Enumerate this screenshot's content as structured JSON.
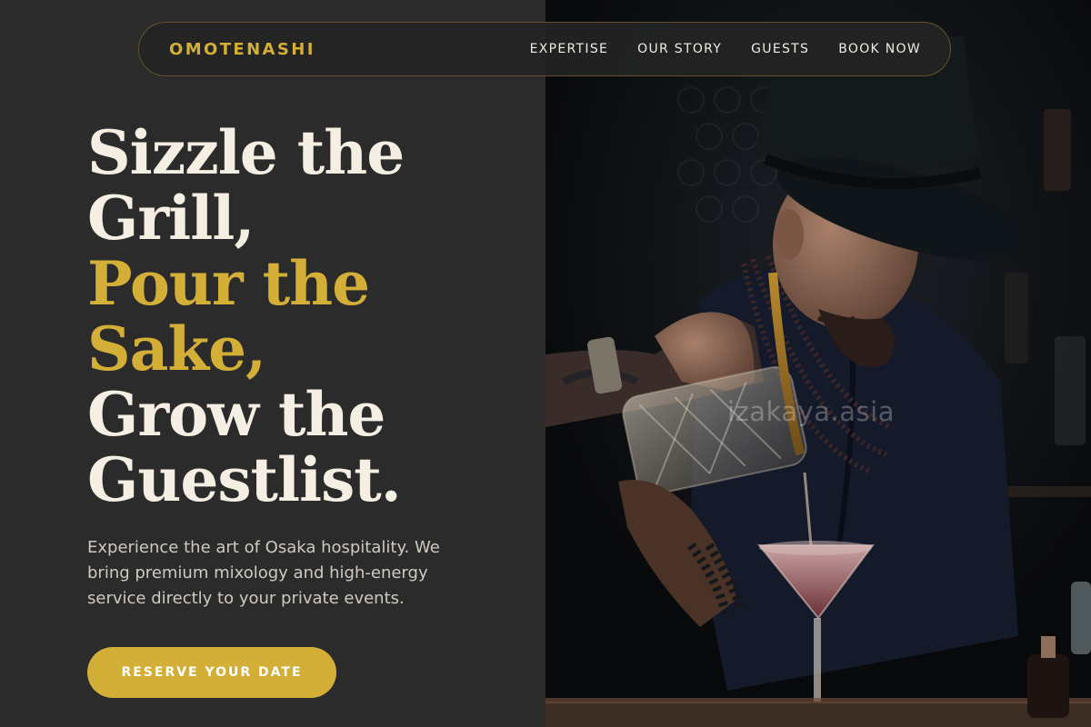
{
  "brand": {
    "name": "OMOTENASHI"
  },
  "nav": {
    "links": [
      {
        "label": "EXPERTISE"
      },
      {
        "label": "OUR STORY"
      },
      {
        "label": "GUESTS"
      },
      {
        "label": "BOOK NOW"
      }
    ]
  },
  "hero": {
    "headline": {
      "line1": "Sizzle the",
      "line2": "Grill,",
      "line3": "Pour the",
      "line4": "Sake,",
      "line5": "Grow the",
      "line6": "Guestlist."
    },
    "subtext": "Experience the art of Osaka hospitality. We bring premium mixology and high-energy service directly to your private events.",
    "cta_label": "RESERVE YOUR DATE"
  },
  "image": {
    "watermark": "izakaya.asia"
  },
  "colors": {
    "accent": "#d4af37",
    "background": "#2b2b2b",
    "heading": "#f5efe3",
    "body_text": "#cfcac1"
  }
}
